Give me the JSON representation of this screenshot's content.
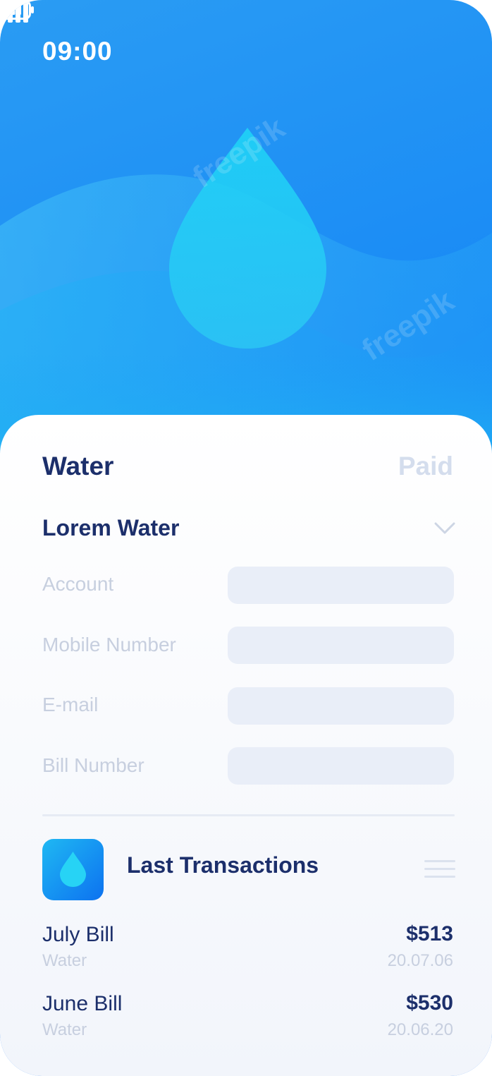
{
  "status_bar": {
    "time": "09:00",
    "signal_icon": "signal-bars-icon",
    "battery_icon": "battery-icon"
  },
  "hero": {
    "illustration": "water-drop-waves",
    "watermark": "freepik"
  },
  "bill": {
    "title": "Water",
    "status": "Paid",
    "provider": "Lorem Water",
    "dropdown_icon": "chevron-down-icon",
    "fields": [
      {
        "label": "Account",
        "value": "",
        "placeholder": ""
      },
      {
        "label": "Mobile Number",
        "value": "",
        "placeholder": ""
      },
      {
        "label": "E-mail",
        "value": "",
        "placeholder": ""
      },
      {
        "label": "Bill Number",
        "value": "",
        "placeholder": ""
      }
    ]
  },
  "transactions": {
    "icon": "water-drop-icon",
    "title": "Last Transactions",
    "menu_icon": "menu-icon",
    "items": [
      {
        "name": "July Bill",
        "category": "Water",
        "amount": "$513",
        "date": "20.07.06"
      },
      {
        "name": "June Bill",
        "category": "Water",
        "amount": "$530",
        "date": "20.06.20"
      }
    ]
  },
  "colors": {
    "brand_blue": "#1687f6",
    "dark_text": "#1c2f6b",
    "muted_text": "#c7cfdf",
    "field_bg": "#e9eef8"
  }
}
